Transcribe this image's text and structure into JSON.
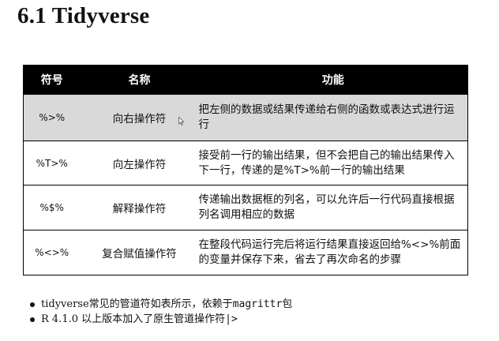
{
  "slide": {
    "title": "6.1 Tidyverse"
  },
  "table": {
    "headers": [
      "符号",
      "名称",
      "功能"
    ],
    "rows": [
      {
        "symbol": "%>%",
        "name": "向右操作符",
        "function": "把左侧的数据或结果传递给右侧的函数或表达式进行运行"
      },
      {
        "symbol": "%T>%",
        "name": "向左操作符",
        "function": "接受前一行的输出结果，但不会把自己的输出结果传入下一行，传递的是%T>%前一行的输出结果"
      },
      {
        "symbol": "%$%",
        "name": "解释操作符",
        "function": "传递输出数据框的列名，可以允许后一行代码直接根据列名调用相应的数据"
      },
      {
        "symbol": "%<>%",
        "name": "复合赋值操作符",
        "function": "在整段代码运行完后将运行结果直接返回给%<>%前面的变量并保存下来，省去了再次命名的步骤"
      }
    ]
  },
  "bullets": {
    "b1_text": "tidyverse常见的管道符如表所示，依赖于",
    "b1_code": "magrittr",
    "b1_tail": "包",
    "b2_text": "R 4.1.0 以上版本加入了原生管道操作符",
    "b2_code": "|>"
  },
  "colors": {
    "header_bg": "#000000",
    "header_text": "#ffffff",
    "shaded_row": "#d9d9d9"
  }
}
